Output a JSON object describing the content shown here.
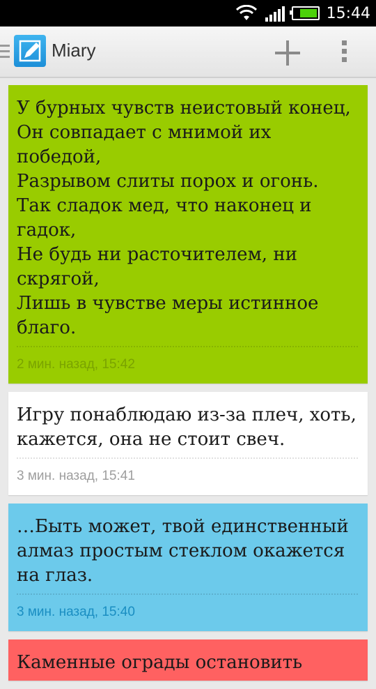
{
  "status_bar": {
    "time": "15:44",
    "battery_level": 0.75
  },
  "app_bar": {
    "title": "Miary"
  },
  "notes": [
    {
      "text": "У бурных чувств неистовый конец,\nОн совпадает с мнимой их победой,\nРазрывом слиты порох и огонь.\nТак сладок мед, что наконец и гадок,\nНе будь ни расточителем, ни скрягой,\nЛишь в чувстве меры истинное благо.",
      "time": "2 мин. назад, 15:42",
      "color": "#99cc00",
      "time_color": "#7aa300"
    },
    {
      "text": "Игру понаблюдаю из-за плеч, хоть, кажется, она не стоит свеч.",
      "time": "3 мин. назад, 15:41",
      "color": "#ffffff",
      "time_color": "#9e9e9e"
    },
    {
      "text": "…Быть может, твой единственный алмаз простым стеклом окажется на глаз.",
      "time": "3 мин. назад, 15:40",
      "color": "#6ccaeb",
      "time_color": "#1a8ec2"
    },
    {
      "text": "Каменные ограды остановить",
      "time": "",
      "color": "#ff6161",
      "time_color": "#c44"
    }
  ]
}
